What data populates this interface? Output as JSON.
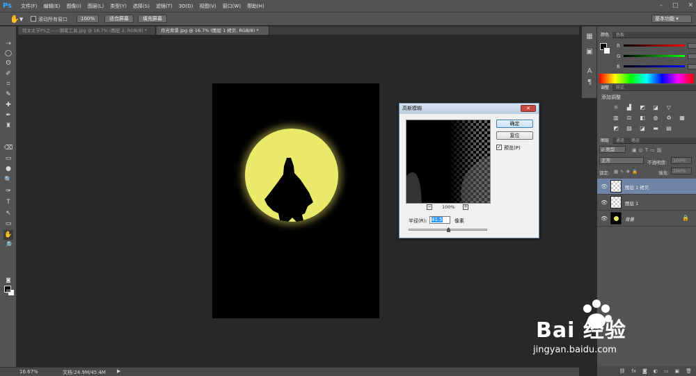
{
  "app": {
    "logo": "Ps"
  },
  "menu": [
    "文件(F)",
    "编辑(E)",
    "图像(I)",
    "图层(L)",
    "类型(Y)",
    "选择(S)",
    "滤镜(T)",
    "3D(D)",
    "视图(V)",
    "窗口(W)",
    "帮助(H)"
  ],
  "window_controls": [
    "–",
    "□",
    "✕"
  ],
  "options": {
    "scroll_all_label": "滚动所有窗口",
    "btn_zoom100": "100%",
    "btn_fit": "适合屏幕",
    "btn_fill": "填充屏幕",
    "workspace": "基本功能"
  },
  "tabs": [
    {
      "label": "程太太学PS之——钢笔工具.jpg @ 16.7% (图层 2, RGB/8) *",
      "active": false
    },
    {
      "label": "月光背景.jpg @ 16.7% (图层 1 拷贝, RGB/8) *",
      "active": true
    }
  ],
  "tools": [
    "⇢",
    "◯",
    "ʘ",
    "✐",
    "⌗",
    "✎",
    "✚",
    "✒",
    "♜",
    "⌫",
    "▭",
    "●",
    "🔍",
    "✑",
    "T",
    "↖",
    "▭",
    "✋",
    "🔎"
  ],
  "status": {
    "zoom": "16.67%",
    "doc": "文档:24.9M/45.4M"
  },
  "panels": {
    "color_tabs": [
      "颜色",
      "色板"
    ],
    "channels": [
      "R",
      "G",
      "B"
    ],
    "adjust_tabs": [
      "调整",
      "样式"
    ],
    "adjust_title": "添加调整",
    "layer_tabs": [
      "图层",
      "通道",
      "路径"
    ],
    "kind_filter": "ρ 类型",
    "blend_mode": "正常",
    "opacity_label": "不透明度:",
    "opacity_value": "100%",
    "lock_label": "锁定:",
    "fill_label": "填充:",
    "fill_value": "100%",
    "layers": [
      {
        "name": "图层 1 拷贝",
        "selected": true
      },
      {
        "name": "图层 1",
        "selected": false
      },
      {
        "name": "背景",
        "selected": false,
        "locked": true
      }
    ]
  },
  "dialog": {
    "title": "高斯模糊",
    "ok": "确定",
    "reset": "复位",
    "preview_label": "预览(P)",
    "zoom_value": "100%",
    "radius_label": "半径(R):",
    "radius_value": "41.5",
    "radius_unit": "像素"
  },
  "watermark": {
    "brand": "Bai 经验",
    "url": "jingyan.baidu.com"
  }
}
